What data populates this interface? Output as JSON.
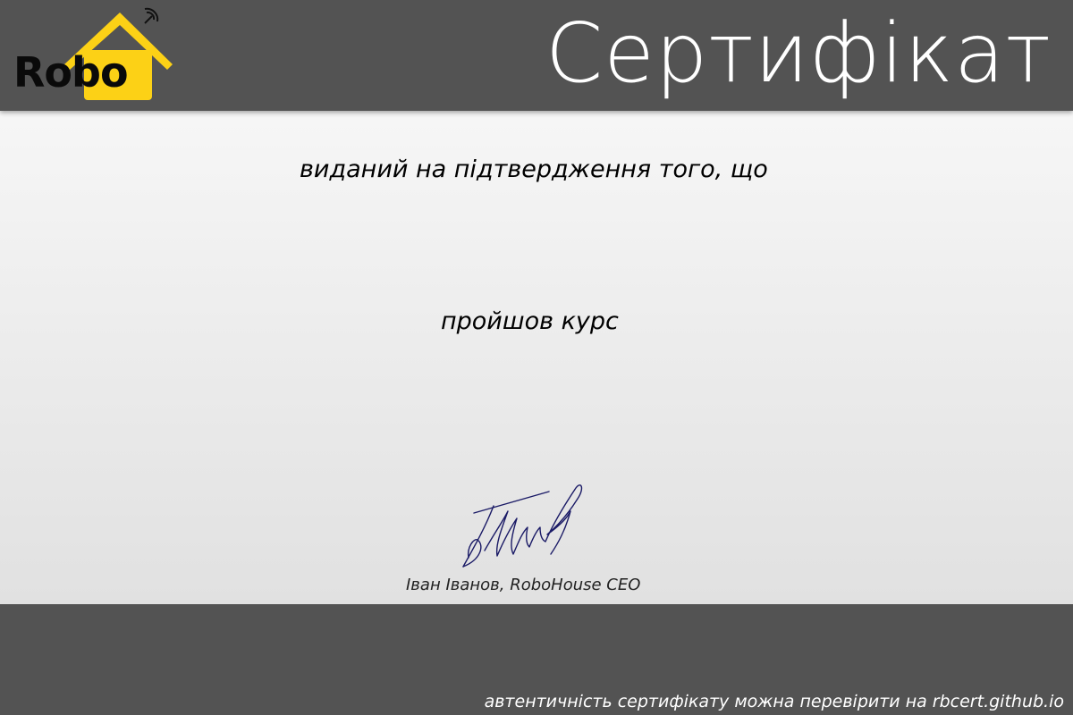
{
  "header": {
    "logo_text": "Robo",
    "title": "Сертифікат"
  },
  "body": {
    "issued_text": "виданий на підтвердження того, що",
    "course_text": "пройшов курс",
    "signer": "Іван Іванов, RoboHouse CEO"
  },
  "footer": {
    "verify_text": "автентичність сертифікату можна перевірити на  rbcert.github.io"
  },
  "colors": {
    "header_bg": "#535353",
    "footer_bg": "#535353",
    "logo_yellow": "#fcd116",
    "signature_ink": "#1a1a66"
  },
  "icons": {
    "logo": "house-roof-logo",
    "antenna": "wifi-antenna-icon",
    "signature": "handwritten-signature"
  }
}
